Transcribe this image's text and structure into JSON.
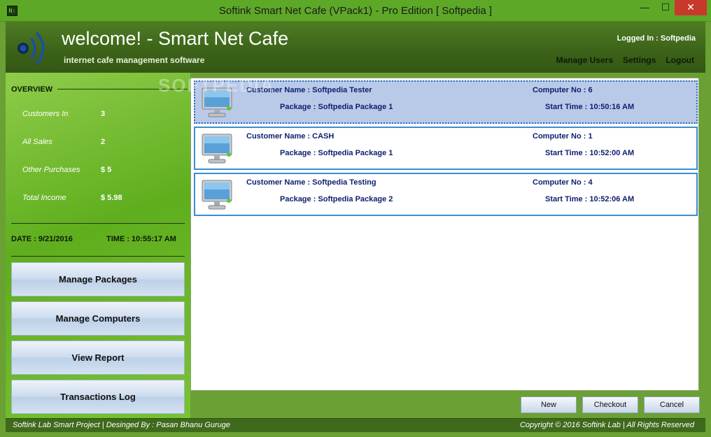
{
  "window": {
    "title": "Softink Smart Net Cafe (VPack1) - Pro Edition [ Softpedia ]",
    "minimize": "—",
    "maximize": "☐",
    "close": "✕",
    "app_icon_text": "N:"
  },
  "header": {
    "welcome": "welcome! - Smart Net Cafe",
    "subtitle": "internet cafe management software",
    "logged_in": "Logged In : Softpedia",
    "links": {
      "manage_users": "Manage Users",
      "settings": "Settings",
      "logout": "Logout"
    }
  },
  "watermark": "SOFTPEDIA",
  "overview": {
    "title": "OVERVIEW",
    "stats": [
      {
        "label": "Customers In",
        "value": "3"
      },
      {
        "label": "All Sales",
        "value": "2"
      },
      {
        "label": "Other Purchases",
        "value": "$ 5"
      },
      {
        "label": "Total Income",
        "value": "$ 5.98"
      }
    ],
    "date": "DATE : 9/21/2016",
    "time": "TIME : 10:55:17 AM"
  },
  "side_buttons": {
    "manage_packages": "Manage Packages",
    "manage_computers": "Manage Computers",
    "view_report": "View Report",
    "transactions_log": "Transactions Log"
  },
  "sessions": [
    {
      "customer": "Customer Name : Softpedia Tester",
      "computer": "Computer No : 6",
      "package": "Package : Softpedia Package 1",
      "start": "Start Time : 10:50:16 AM"
    },
    {
      "customer": "Customer Name : CASH",
      "computer": "Computer No : 1",
      "package": "Package : Softpedia Package 1",
      "start": "Start Time : 10:52:00 AM"
    },
    {
      "customer": "Customer Name : Softpedia Testing",
      "computer": "Computer No : 4",
      "package": "Package : Softpedia Package 2",
      "start": "Start Time : 10:52:06 AM"
    }
  ],
  "actions": {
    "new": "New",
    "checkout": "Checkout",
    "cancel": "Cancel"
  },
  "status": {
    "left": "Softink Lab Smart Project | Desinged By : Pasan Bhanu Guruge",
    "right": "Copyright © 2016 Softink Lab | All Rights Reserved"
  },
  "colors": {
    "header_green": "#3b6218",
    "sidebar_green": "#5fae1e",
    "card_border": "#3a8ed4",
    "card_selected": "#b9c9e8",
    "text_navy": "#0c1f6e"
  }
}
